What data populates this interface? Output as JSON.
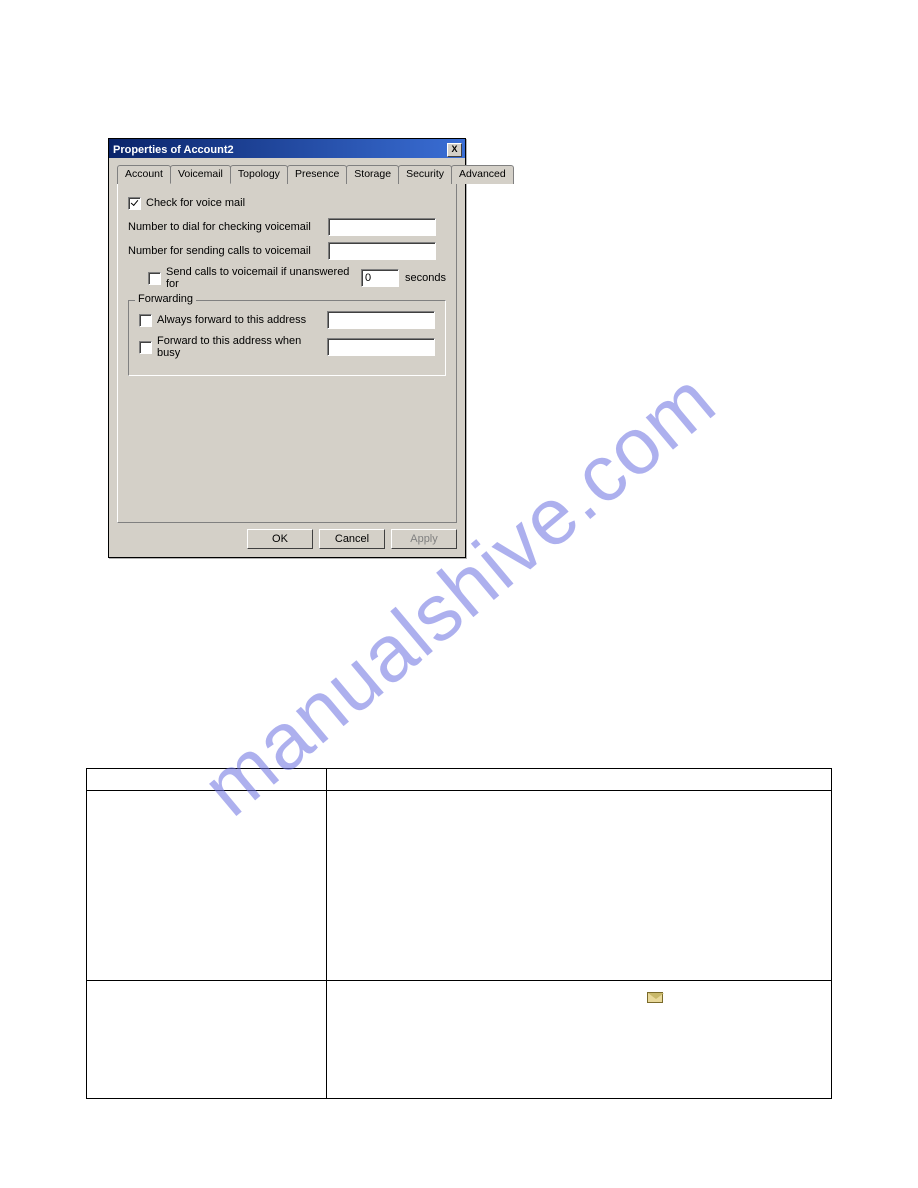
{
  "watermark": "manualshive.com",
  "dialog": {
    "title": "Properties of Account2",
    "close": "X",
    "tabs": {
      "account": "Account",
      "voicemail": "Voicemail",
      "topology": "Topology",
      "presence": "Presence",
      "storage": "Storage",
      "security": "Security",
      "advanced": "Advanced"
    },
    "voicemail": {
      "check_label": "Check for voice mail",
      "number_dial_label": "Number to dial for checking voicemail",
      "number_dial_value": "",
      "number_send_label": "Number for sending calls to voicemail",
      "number_send_value": "",
      "send_unanswered_label": "Send calls to voicemail if unanswered for",
      "send_unanswered_value": "0",
      "seconds_label": "seconds"
    },
    "forwarding": {
      "legend": "Forwarding",
      "always_label": "Always forward to this address",
      "always_value": "",
      "busy_label": "Forward to this address when busy",
      "busy_value": ""
    },
    "buttons": {
      "ok": "OK",
      "cancel": "Cancel",
      "apply": "Apply"
    }
  },
  "table": {
    "h1": "",
    "h2": "",
    "r1c1": "",
    "r1c2": "",
    "r2c1": "",
    "r2c2": ""
  }
}
